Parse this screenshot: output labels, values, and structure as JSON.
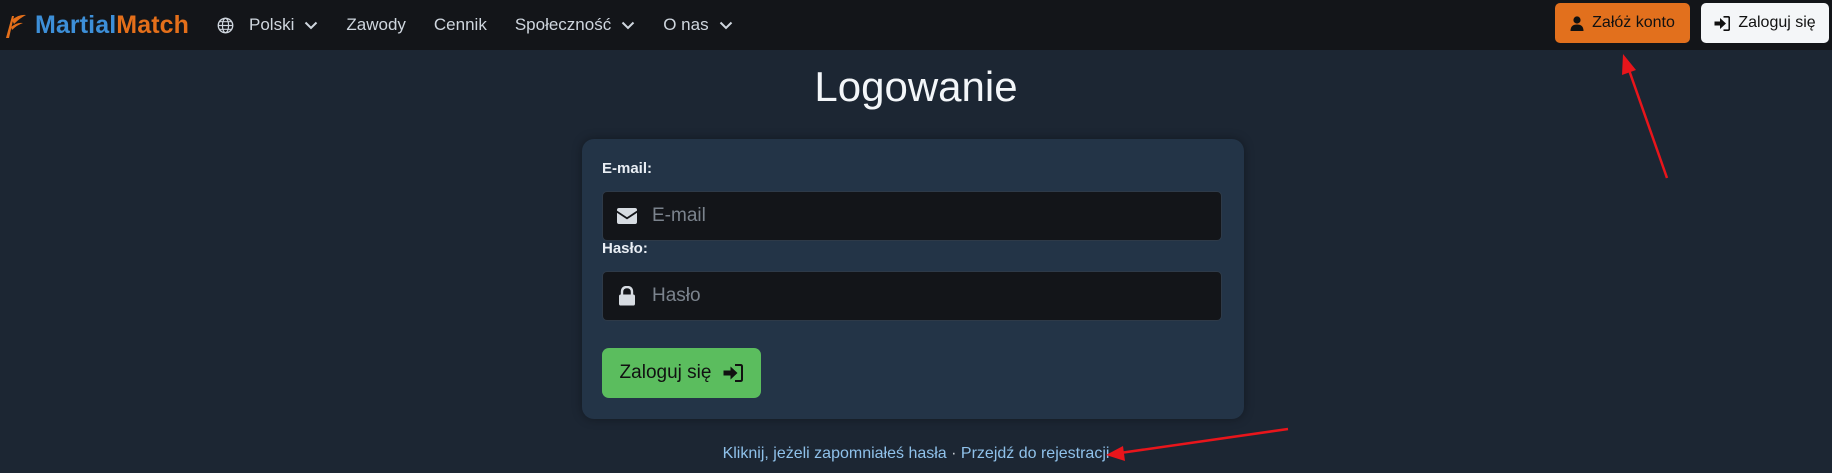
{
  "brand": {
    "part1": "Martial",
    "part2": "Match",
    "colors": {
      "martial": "#3d8fd8",
      "match": "#e46f1a"
    }
  },
  "nav": {
    "language": "Polski",
    "items": [
      {
        "label": "Zawody"
      },
      {
        "label": "Cennik"
      },
      {
        "label": "Społeczność"
      },
      {
        "label": "O nas"
      }
    ]
  },
  "actions": {
    "register_label": "Załóż konto",
    "login_label": "Zaloguj się",
    "register_icon": "user-icon",
    "login_icon": "sign-in-icon"
  },
  "login": {
    "title": "Logowanie",
    "email_label": "E-mail:",
    "email_placeholder": "E-mail",
    "email_icon": "envelope-icon",
    "password_label": "Hasło:",
    "password_placeholder": "Hasło",
    "password_icon": "lock-icon",
    "submit_label": "Zaloguj się",
    "submit_icon": "sign-in-icon"
  },
  "footer": {
    "forgot_link": "Kliknij, jeżeli zapomniałeś hasła",
    "separator": "·",
    "register_link": "Przejdź do rejestracji"
  },
  "theme": {
    "background": "#1c2633",
    "navbar": "#131519",
    "card": "#233447",
    "accent_orange": "#e2701d",
    "accent_green": "#5bbd5e",
    "link": "#8fc1ea",
    "annotation_arrow": "#e8151b"
  }
}
